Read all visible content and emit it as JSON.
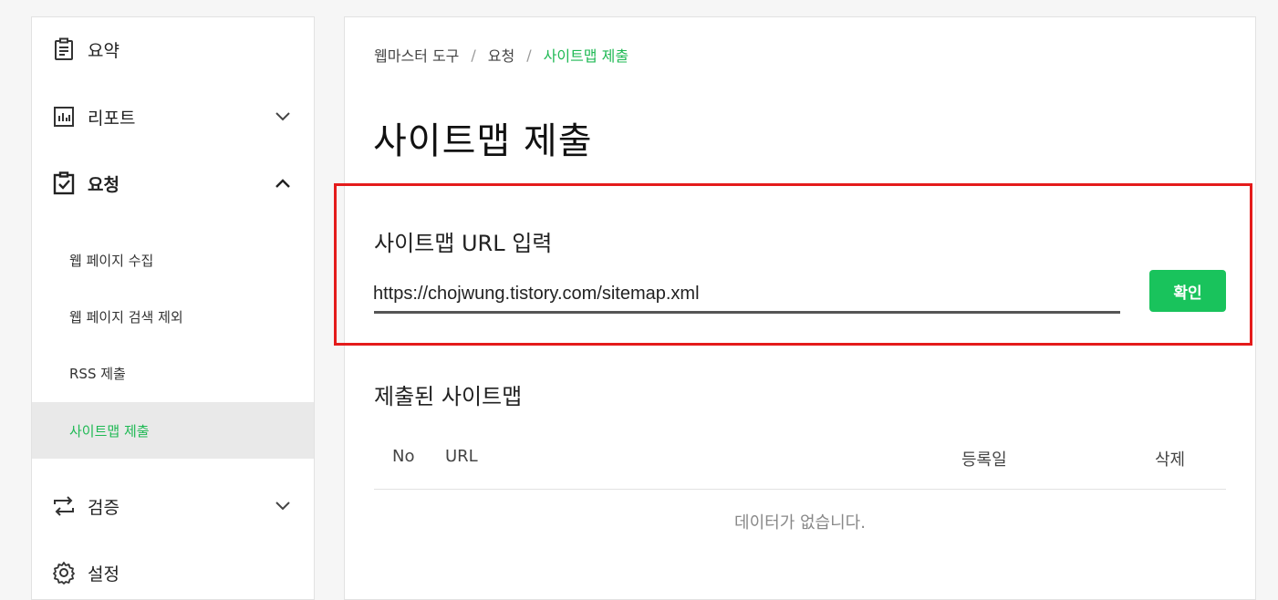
{
  "sidebar": {
    "items": [
      {
        "label": "요약",
        "icon": "clipboard-icon"
      },
      {
        "label": "리포트",
        "icon": "chart-icon"
      },
      {
        "label": "요청",
        "icon": "clipboard-check-icon"
      },
      {
        "label": "검증",
        "icon": "swap-arrows-icon"
      },
      {
        "label": "설정",
        "icon": "gear-icon"
      }
    ],
    "subitems": [
      {
        "label": "웹 페이지 수집"
      },
      {
        "label": "웹 페이지 검색 제외"
      },
      {
        "label": "RSS 제출"
      },
      {
        "label": "사이트맵 제출"
      }
    ]
  },
  "breadcrumb": {
    "items": [
      "웹마스터 도구",
      "요청",
      "사이트맵 제출"
    ],
    "separator": "/"
  },
  "main": {
    "title": "사이트맵 제출",
    "url_section_label": "사이트맵 URL 입력",
    "url_value": "https://chojwung.tistory.com/sitemap.xml",
    "confirm_label": "확인",
    "submitted_label": "제출된 사이트맵",
    "table": {
      "headers": [
        "No",
        "URL",
        "등록일",
        "삭제"
      ],
      "empty_message": "데이터가 없습니다."
    }
  },
  "colors": {
    "accent": "#1fb954",
    "button": "#19c35c",
    "highlight_box": "#e41b1b"
  }
}
